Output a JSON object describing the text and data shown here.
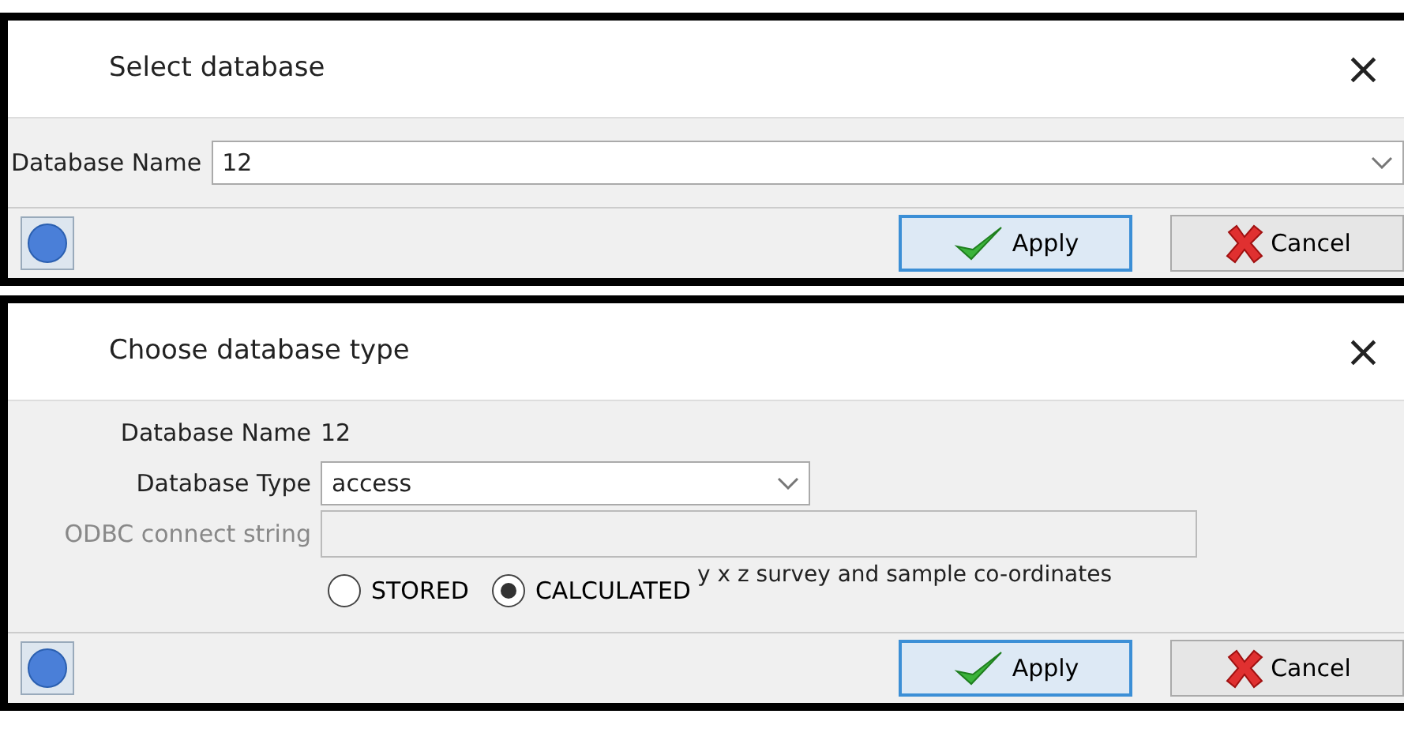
{
  "dialogs": [
    {
      "title": "Select database",
      "close": "×",
      "kind": "select",
      "fields": [
        {
          "kind": "combo",
          "label": "Database Name",
          "value": "12"
        }
      ],
      "buttons": [
        {
          "kind": "apply",
          "label": "Apply",
          "selected": true
        },
        {
          "kind": "cancel",
          "label": "Cancel",
          "selected": false
        }
      ]
    },
    {
      "title": "Choose database type",
      "close": "×",
      "kind": "type",
      "fields": [
        {
          "kind": "text",
          "label": "Database Name",
          "value": "12"
        },
        {
          "kind": "combo",
          "label": "Database Type",
          "value": "access"
        },
        {
          "kind": "input",
          "label": "ODBC connect string",
          "disabled": true
        }
      ],
      "radios": [
        {
          "label": "STORED",
          "selected": false
        },
        {
          "label": "CALCULATED",
          "selected": true
        }
      ],
      "radio_note": "y x z survey and sample co-ordinates",
      "buttons": [
        {
          "kind": "apply",
          "label": "Apply",
          "selected": true
        },
        {
          "kind": "cancel",
          "label": "Cancel",
          "selected": false
        }
      ]
    }
  ]
}
